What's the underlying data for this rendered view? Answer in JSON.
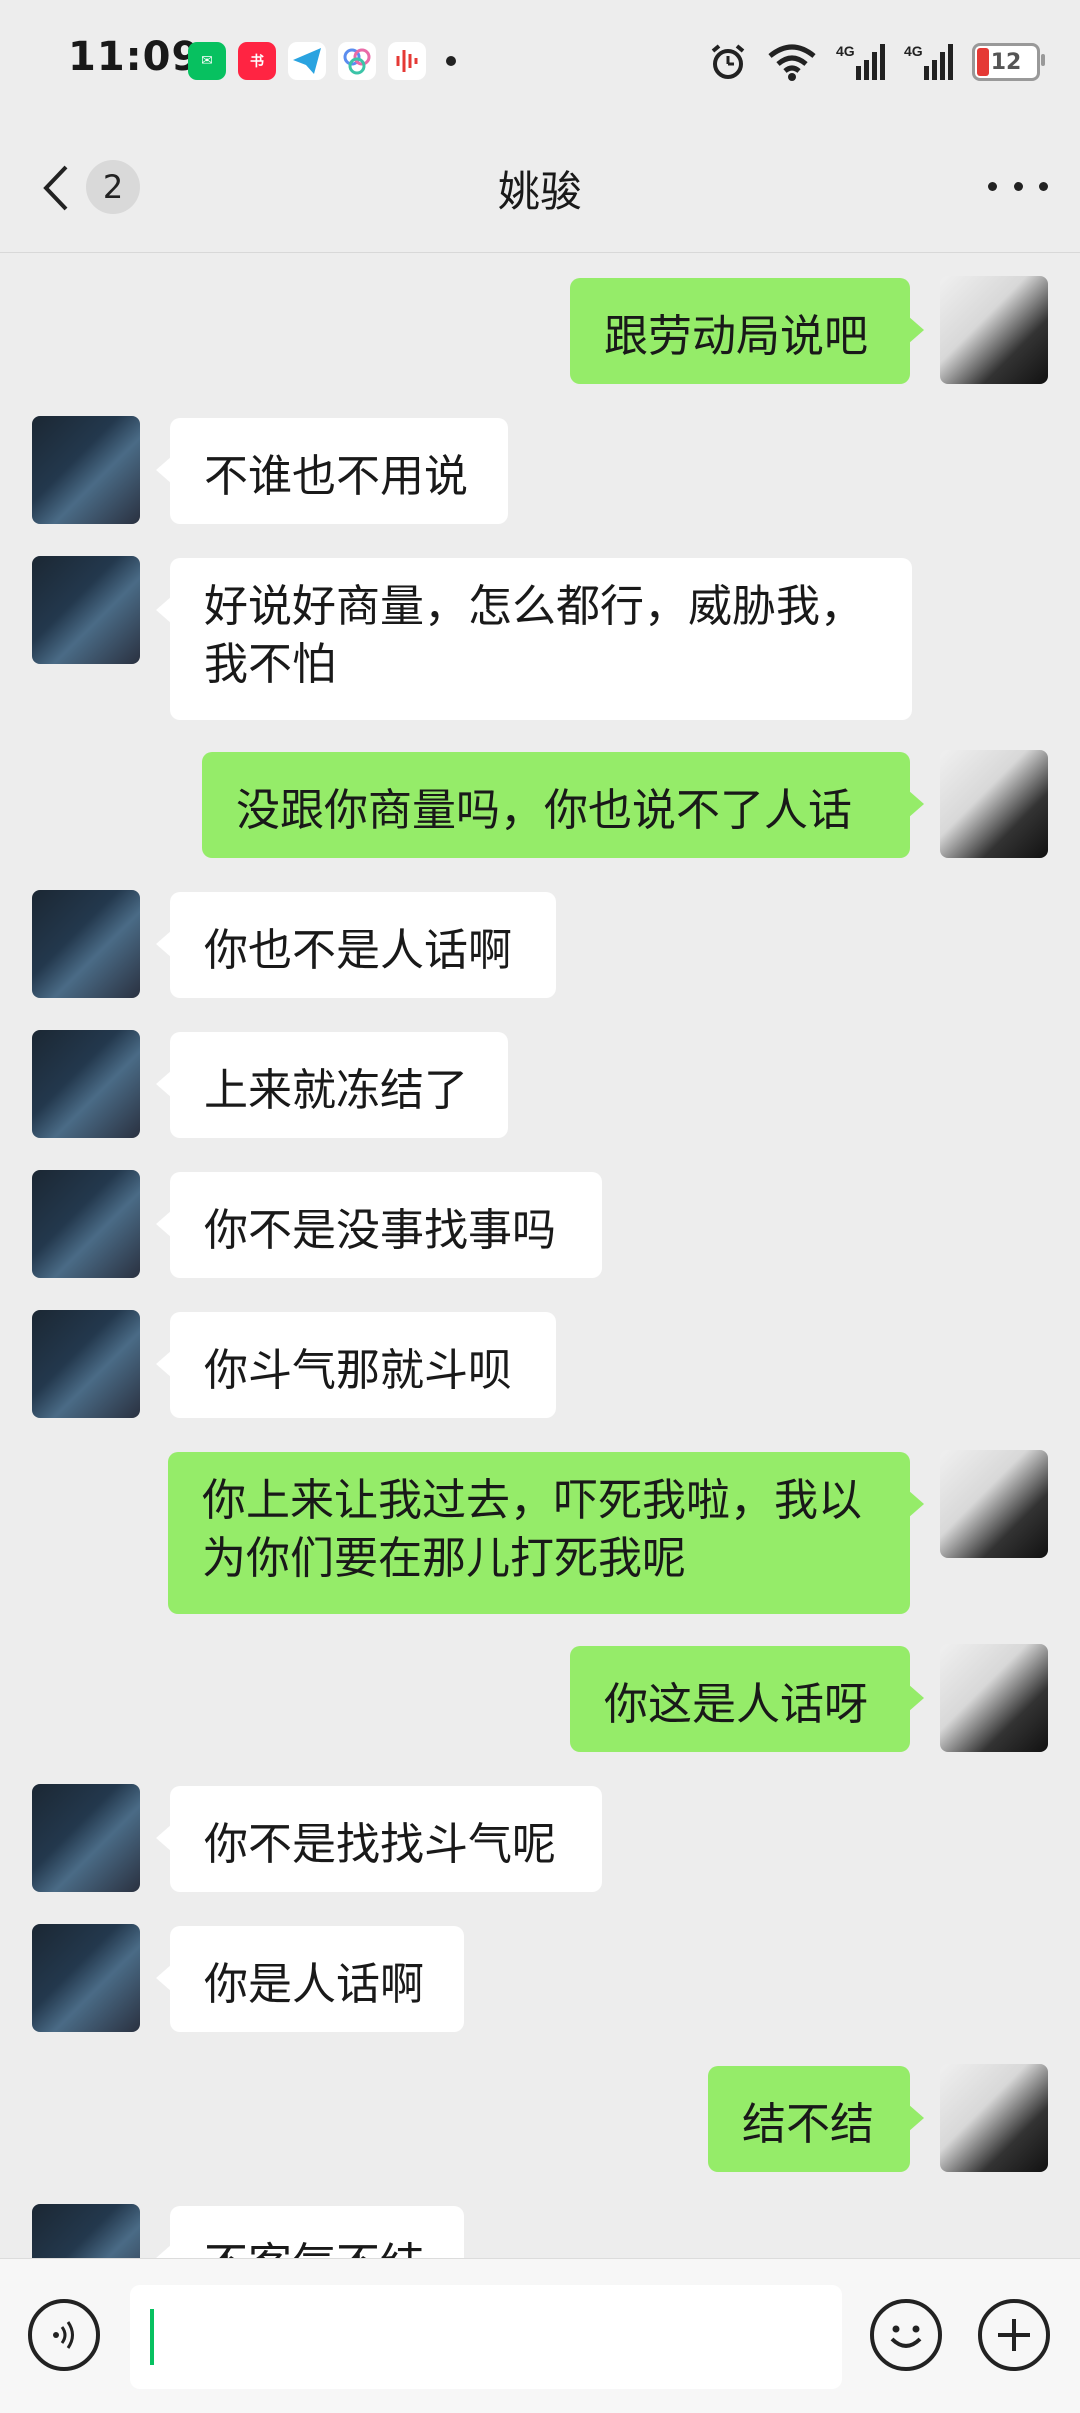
{
  "status": {
    "time": "11:09",
    "notif_icons": [
      "wechat-icon",
      "xiaohongshu-icon",
      "telegram-icon",
      "app-icon",
      "audio-app-icon"
    ],
    "battery_level": "12"
  },
  "header": {
    "back_count": "2",
    "title": "姚骏",
    "more_icon": "more-icon"
  },
  "messages": [
    {
      "side": "self",
      "text": "跟劳动局说吧"
    },
    {
      "side": "other",
      "text": "不谁也不用说"
    },
    {
      "side": "other",
      "text": "好说好商量，怎么都行，威胁我，\n我不怕"
    },
    {
      "side": "self",
      "text": "没跟你商量吗，你也说不了人话"
    },
    {
      "side": "other",
      "text": "你也不是人话啊"
    },
    {
      "side": "other",
      "text": "上来就冻结了"
    },
    {
      "side": "other",
      "text": "你不是没事找事吗"
    },
    {
      "side": "other",
      "text": "你斗气那就斗呗"
    },
    {
      "side": "self",
      "text": "你上来让我过去，吓死我啦，我以\n为你们要在那儿打死我呢"
    },
    {
      "side": "self",
      "text": "你这是人话呀"
    },
    {
      "side": "other",
      "text": "你不是找找斗气呢"
    },
    {
      "side": "other",
      "text": "你是人话啊"
    },
    {
      "side": "self",
      "text": "结不结"
    },
    {
      "side": "other",
      "text": "不客气不结"
    }
  ],
  "input": {
    "value": "",
    "voice_icon": "voice-icon",
    "emoji_icon": "emoji-icon",
    "plus_icon": "plus-icon"
  }
}
